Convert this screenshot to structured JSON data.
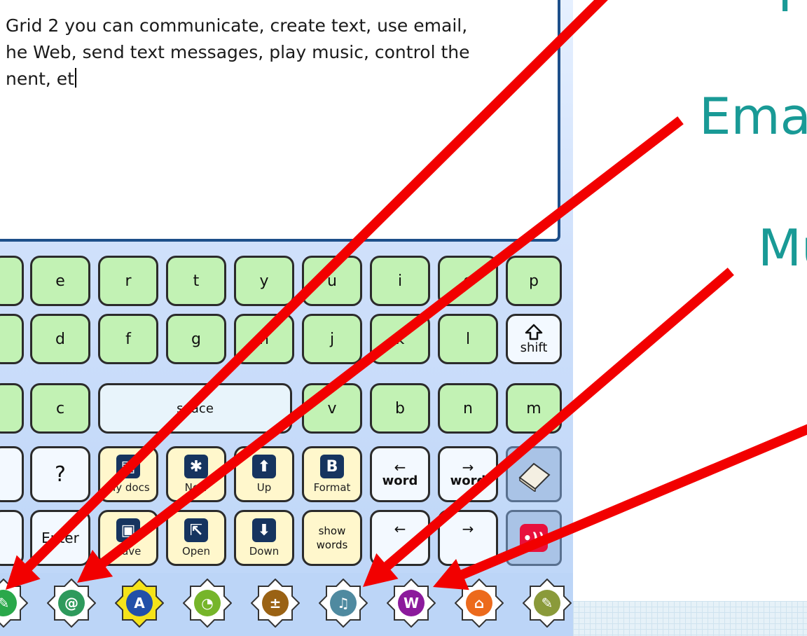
{
  "text_area": {
    "line1": "Grid 2 you can communicate, create text, use email,",
    "line2": "he Web, send text messages, play music, control the",
    "line3": "nent, et"
  },
  "keyboard": {
    "row1": [
      "e",
      "r",
      "t",
      "y",
      "u",
      "i",
      "o",
      "p"
    ],
    "row2": [
      "d",
      "f",
      "g",
      "h",
      "j",
      "k",
      "l"
    ],
    "shift_label": "shift",
    "row3": [
      "c",
      "v",
      "b",
      "n",
      "m"
    ],
    "space_label": "space",
    "row4": {
      "question": "?",
      "my_docs": "My docs",
      "new": "New",
      "up": "Up",
      "format": "Format",
      "word_left": "word",
      "word_right": "word"
    },
    "row5": {
      "enter": "Enter",
      "save": "Save",
      "open": "Open",
      "down": "Down",
      "show_words": "show words"
    }
  },
  "tools": [
    {
      "name": "chat",
      "icon": "speech-icon",
      "color": "#2aa84a"
    },
    {
      "name": "email",
      "icon": "at-sign-icon",
      "color": "#2e9a5c"
    },
    {
      "name": "writing",
      "icon": "writing-icon",
      "color": "#2250a8"
    },
    {
      "name": "clock",
      "icon": "clock-icon",
      "color": "#76b52a"
    },
    {
      "name": "calculator",
      "icon": "calculator-icon",
      "color": "#9a6214"
    },
    {
      "name": "music",
      "icon": "music-note-icon",
      "color": "#4f8aa0"
    },
    {
      "name": "web",
      "icon": "web-icon",
      "color": "#8c1a9c"
    },
    {
      "name": "environment",
      "icon": "environment-icon",
      "color": "#ec6a1c"
    },
    {
      "name": "settings",
      "icon": "wrench-icon",
      "color": "#8a9a3a"
    }
  ],
  "slide": {
    "email_label": "Ema",
    "music_label": "Mu"
  },
  "colors": {
    "arrow": "#f20000",
    "slide_text": "#199a96",
    "frame": "#1d4f8a"
  }
}
